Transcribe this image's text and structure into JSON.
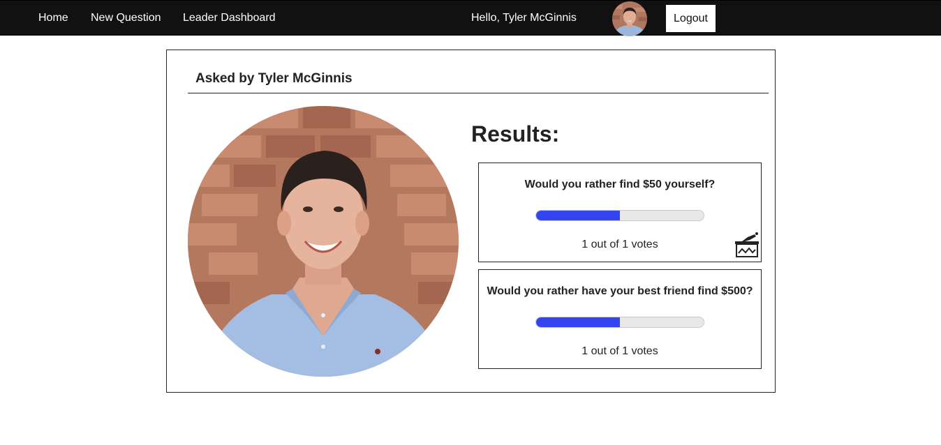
{
  "nav": {
    "home": "Home",
    "new_question": "New Question",
    "leader_dashboard": "Leader Dashboard",
    "greeting": "Hello, Tyler McGinnis",
    "logout": "Logout"
  },
  "question": {
    "asked_by": "Asked by Tyler McGinnis",
    "results_title": "Results:",
    "options": [
      {
        "text": "Would you rather find $50 yourself?",
        "votes_text": "1 out of 1 votes",
        "fill_fraction": 0.5,
        "voted": true
      },
      {
        "text": "Would you rather have your best friend find $500?",
        "votes_text": "1 out of 1 votes",
        "fill_fraction": 0.5,
        "voted": false
      }
    ]
  },
  "icons": {
    "voted": "ballot-box-icon"
  },
  "colors": {
    "navbar": "#111111",
    "progress_fill": "#3344f0",
    "progress_track": "#e8e8e8"
  }
}
